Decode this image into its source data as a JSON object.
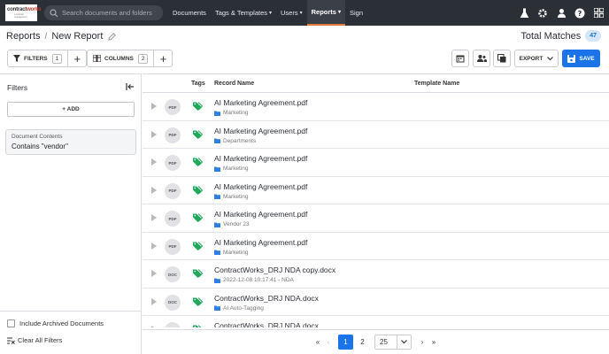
{
  "nav": {
    "logo_brand": "contract",
    "logo_brand2": "works",
    "logo_tagline": "a contract management",
    "search_placeholder": "Search documents and folders",
    "links": [
      {
        "label": "Documents",
        "caret": ""
      },
      {
        "label": "Tags & Templates",
        "caret": "▾"
      },
      {
        "label": "Users",
        "caret": "▾"
      },
      {
        "label": "Reports",
        "caret": "▾",
        "active": true
      },
      {
        "label": "Sign",
        "caret": ""
      }
    ],
    "icons": [
      "flask-icon",
      "gear-icon",
      "user-icon",
      "help-icon",
      "apps-grid-icon"
    ]
  },
  "header": {
    "breadcrumb_root": "Reports",
    "breadcrumb_sep": "/",
    "breadcrumb_current": "New Report",
    "total_label": "Total Matches",
    "total_count": "47"
  },
  "toolbar": {
    "filters_label": "FILTERS",
    "filters_count": "1",
    "columns_label": "COLUMNS",
    "columns_count": "2",
    "plus": "+",
    "export_label": "EXPORT",
    "save_label": "SAVE"
  },
  "sidebar": {
    "title": "Filters",
    "add_label": "+ ADD",
    "filter": {
      "title": "Document Contents",
      "value": "Contains \"vendor\""
    },
    "include_archived_label": "Include Archived Documents",
    "include_archived_checked": false,
    "clear_all_label": "Clear All Filters"
  },
  "table": {
    "columns": [
      "Tags",
      "Record Name",
      "Template Name"
    ],
    "rows": [
      {
        "type": "PDF",
        "name": "AI Marketing Agreement.pdf",
        "folder": "Marketing"
      },
      {
        "type": "PDF",
        "name": "AI Marketing Agreement.pdf",
        "folder": "Departments"
      },
      {
        "type": "PDF",
        "name": "AI Marketing Agreement.pdf",
        "folder": "Marketing"
      },
      {
        "type": "PDF",
        "name": "AI Marketing Agreement.pdf",
        "folder": "Marketing"
      },
      {
        "type": "PDF",
        "name": "AI Marketing Agreement.pdf",
        "folder": "Vendor 23"
      },
      {
        "type": "PDF",
        "name": "AI Marketing Agreement.pdf",
        "folder": "Marketing"
      },
      {
        "type": "DOC",
        "name": "ContractWorks_DRJ NDA copy.docx",
        "folder": "2022-12-08 10:17:41 - NDA"
      },
      {
        "type": "DOC",
        "name": "ContractWorks_DRJ NDA.docx",
        "folder": "AI Auto-Tagging"
      },
      {
        "type": "DOC",
        "name": "ContractWorks_DRJ NDA.docx",
        "folder": ""
      }
    ]
  },
  "pagination": {
    "first": "«",
    "prev": "‹",
    "pages": [
      "1",
      "2"
    ],
    "current": "1",
    "next": "›",
    "last": "»",
    "page_size": "25"
  },
  "colors": {
    "accent": "#1a73e8",
    "nav_bg": "#2b2f36",
    "tag_green": "#1fa85a",
    "folder_blue": "#2e7fe0",
    "active_underline": "#e07b39"
  }
}
